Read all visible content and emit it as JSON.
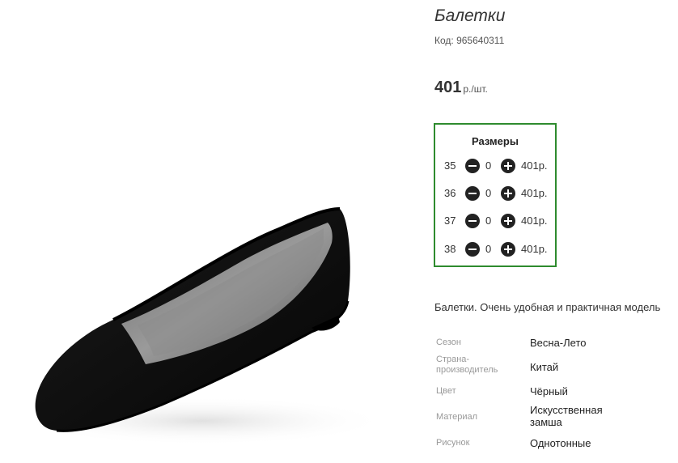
{
  "product": {
    "title": "Балетки",
    "code_label": "Код: 965640311",
    "price_amount": "401",
    "price_unit": "р./шт."
  },
  "sizes": {
    "title": "Размеры",
    "rows": [
      {
        "size": "35",
        "qty": "0",
        "price": "401р."
      },
      {
        "size": "36",
        "qty": "0",
        "price": "401р."
      },
      {
        "size": "37",
        "qty": "0",
        "price": "401р."
      },
      {
        "size": "38",
        "qty": "0",
        "price": "401р."
      }
    ]
  },
  "description": "Балетки. Очень удобная и практичная модель",
  "attributes": [
    {
      "label": "Сезон",
      "value": "Весна-Лето"
    },
    {
      "label": "Страна-производитель",
      "value": "Китай"
    },
    {
      "label": "Цвет",
      "value": "Чёрный"
    },
    {
      "label": "Материал",
      "value": "Искусственная замша"
    },
    {
      "label": "Рисунок",
      "value": "Однотонные"
    }
  ],
  "colors": {
    "sizes_border": "#2e8b2e",
    "button_fill": "#222222"
  },
  "icons": {
    "decrease": "minus-circle-icon",
    "increase": "plus-circle-icon"
  }
}
